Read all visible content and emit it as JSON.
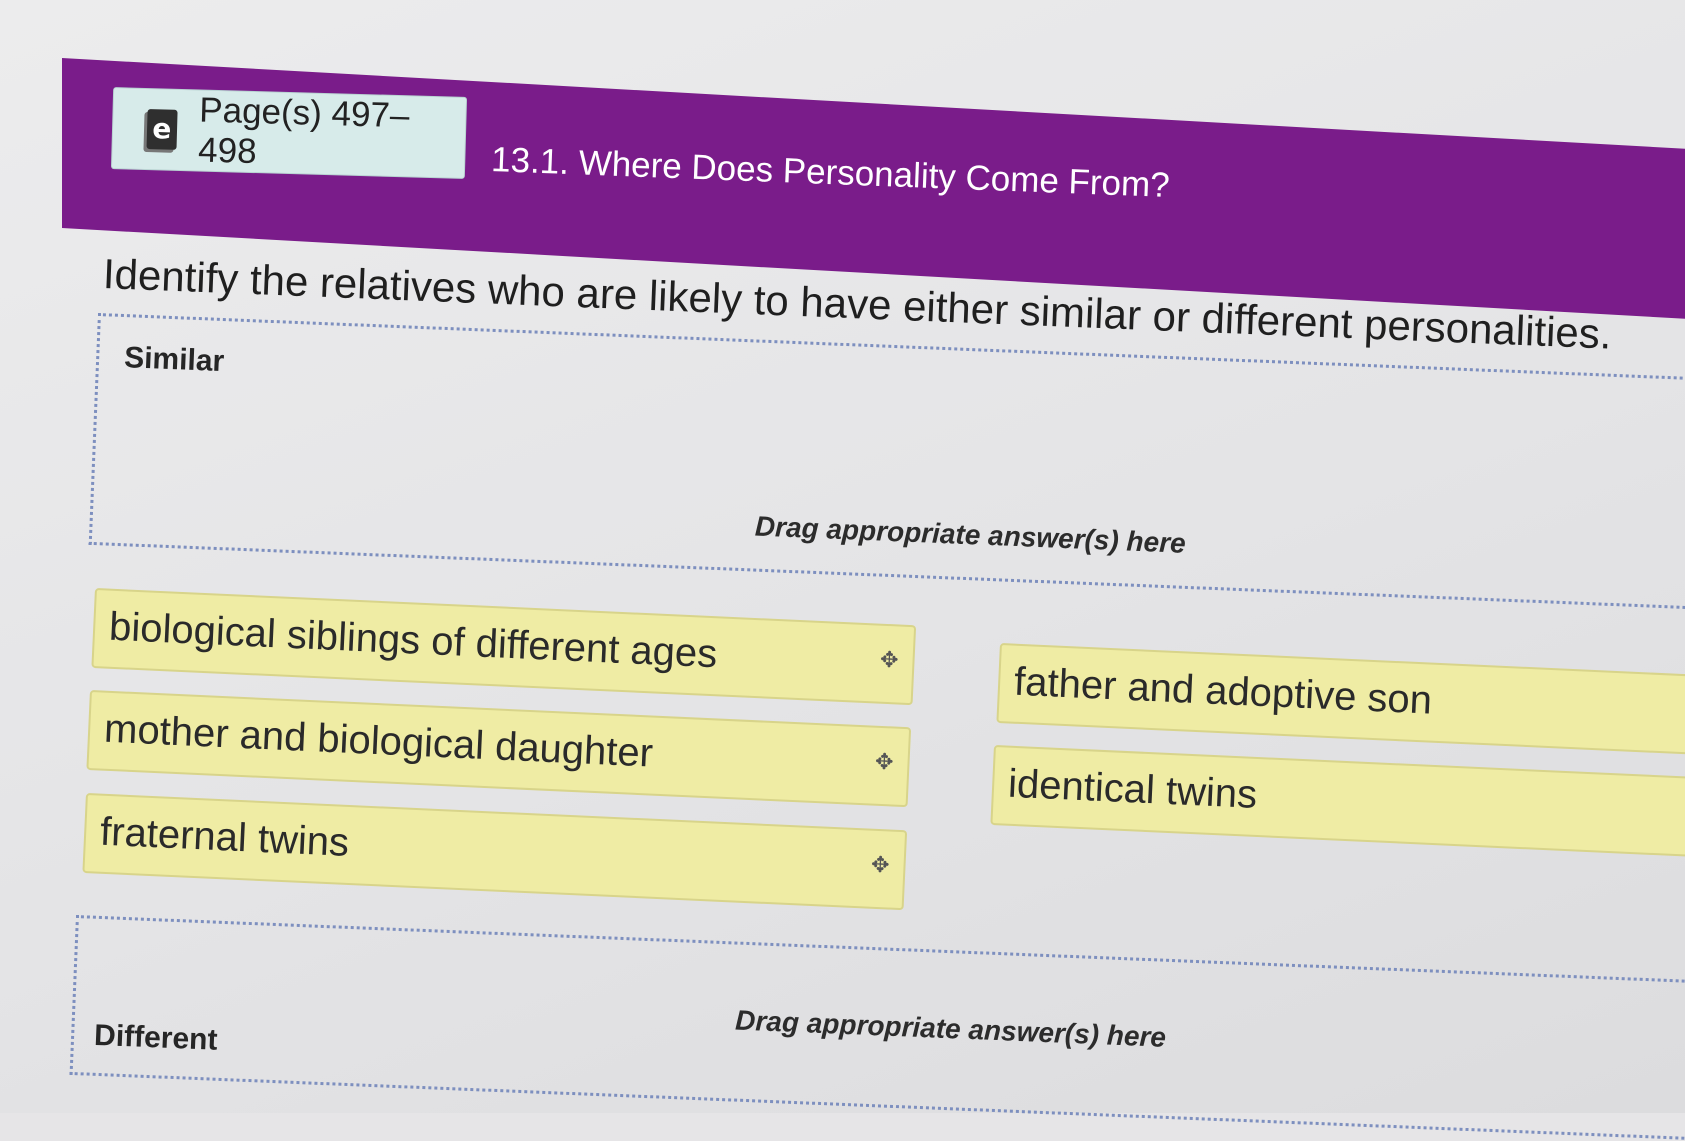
{
  "header": {
    "ebook_label": "Page(s) 497–498",
    "ebook_icon": "e",
    "section_title": "13.1. Where Does Personality Come From?"
  },
  "question": {
    "prompt": "Identify the relatives who are likely to have either similar or different personalities."
  },
  "zones": {
    "similar": {
      "label": "Similar",
      "hint": "Drag appropriate answer(s) here"
    },
    "different": {
      "label": "Different",
      "hint": "Drag appropriate answer(s) here"
    }
  },
  "answers": [
    "biological siblings of different ages",
    "mother and biological daughter",
    "fraternal twins",
    "father and adoptive son",
    "identical twins"
  ],
  "colors": {
    "banner": "#7a1c8a",
    "chip": "#efeca4",
    "ebook_button": "#d7ebea",
    "zone_border": "#7d8fbf"
  },
  "icons": {
    "ebook": "ebook-icon",
    "move": "move-handle-icon"
  }
}
